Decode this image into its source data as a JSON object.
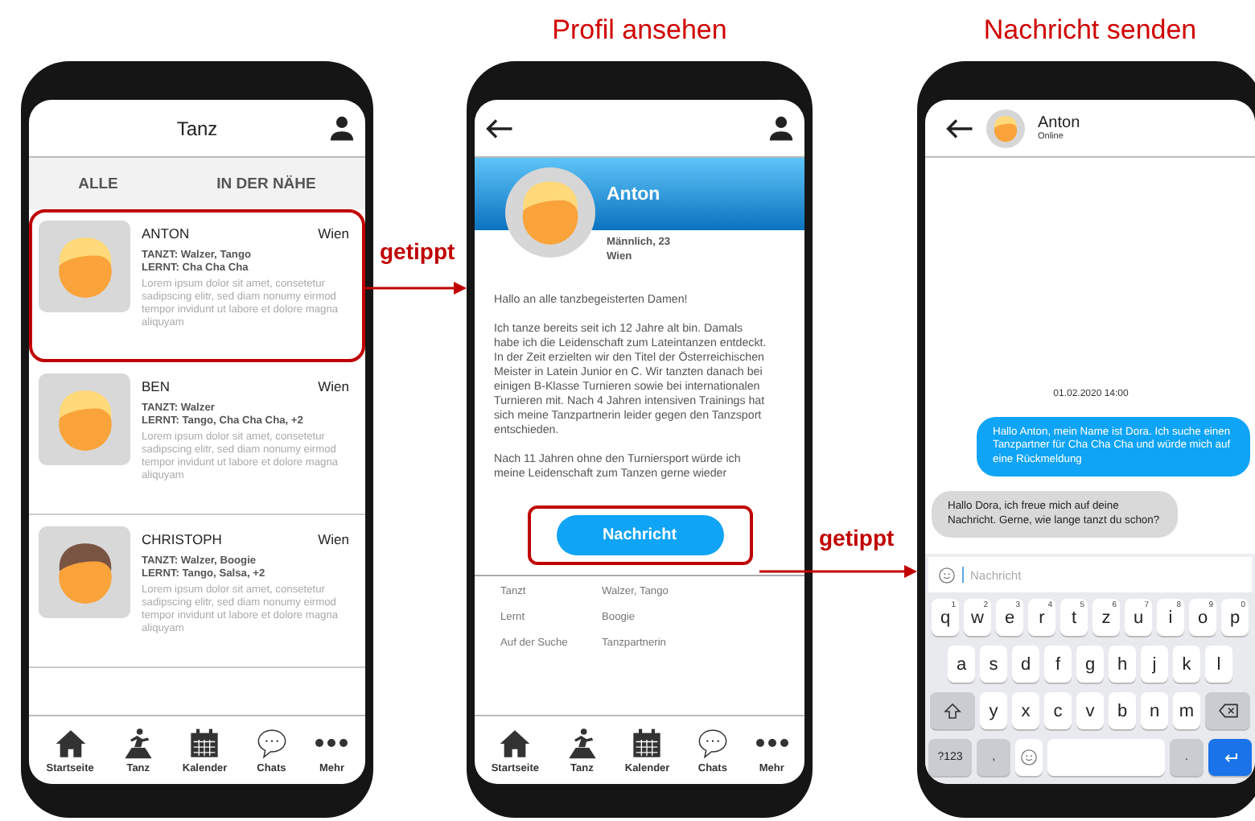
{
  "screens": [
    {
      "kind": "list",
      "header": {
        "title": "Tanz"
      },
      "tabs": [
        {
          "label": "ALLE"
        },
        {
          "label": "IN DER NÄHE"
        }
      ],
      "cards": [
        {
          "name": "ANTON",
          "city": "Wien",
          "dances": "TANZT: Walzer, Tango",
          "learns": "LERNT: Cha Cha Cha",
          "text": "Lorem ipsum dolor sit amet, consetetur sadipscing elitr, sed diam nonumy eirmod tempor invidunt ut labore et dolore magna aliquyam",
          "color": "#ffd97a",
          "highlighted": true
        },
        {
          "name": "BEN",
          "city": "Wien",
          "dances": "TANZT: Walzer",
          "learns": "LERNT: Tango, Cha Cha Cha, +2",
          "text": "Lorem ipsum dolor sit amet, consetetur sadipscing elitr, sed diam nonumy eirmod tempor invidunt ut labore et dolore magna aliquyam",
          "color": "#ffd97a",
          "highlighted": false
        },
        {
          "name": "CHRISTOPH",
          "city": "Wien",
          "dances": "TANZT: Walzer, Boogie",
          "learns": "LERNT: Tango, Salsa, +2",
          "text": "Lorem ipsum dolor sit amet, consetetur sadipscing elitr, sed diam nonumy eirmod tempor invidunt ut labore et dolore magna aliquyam",
          "color": "#7a5443",
          "highlighted": false
        }
      ],
      "nav": [
        {
          "kind": "home",
          "label": "Startseite"
        },
        {
          "kind": "dance",
          "label": "Tanz"
        },
        {
          "kind": "calendar",
          "label": "Kalender"
        },
        {
          "kind": "chats",
          "label": "Chats"
        },
        {
          "kind": "more",
          "label": "Mehr"
        }
      ],
      "transition": {
        "label": "getippt"
      }
    },
    {
      "kind": "profile",
      "title": "Profil ansehen",
      "name": "Anton",
      "details": [
        "Männlich, 23",
        "Wien"
      ],
      "bio": [
        "Hallo an alle tanzbegeisterten Damen!",
        "Ich tanze bereits seit ich 12 Jahre alt bin. Damals habe ich die Leidenschaft zum Lateintanzen entdeckt.\nIn der Zeit erzielten wir den Titel der Österreichischen Meister in Latein Junior en C. Wir tanzten danach bei einigen B-Klasse Turnieren sowie bei internationalen Turnieren mit. Nach 4 Jahren intensiven Trainings hat sich meine Tanzpartnerin leider gegen den Tanzsport entschieden.",
        "Nach 11 Jahren ohne den Turniersport würde ich meine Leidenschaft zum Tanzen gerne wieder"
      ],
      "action": {
        "label": "Nachricht",
        "highlighted": true
      },
      "facts": [
        {
          "label": "Tanzt",
          "value": "Walzer, Tango"
        },
        {
          "label": "Lernt",
          "value": "Boogie"
        },
        {
          "label": "Auf der Suche",
          "value": "Tanzpartnerin"
        }
      ],
      "nav": [
        {
          "kind": "home",
          "label": "Startseite"
        },
        {
          "kind": "dance",
          "label": "Tanz"
        },
        {
          "kind": "calendar",
          "label": "Kalender"
        },
        {
          "kind": "chats",
          "label": "Chats"
        },
        {
          "kind": "more",
          "label": "Mehr"
        }
      ],
      "transition": {
        "label": "getippt"
      }
    },
    {
      "kind": "chat",
      "title": "Nachricht senden",
      "contact": {
        "name": "Anton",
        "status": "Online"
      },
      "date": "01.02.2020 14:00",
      "messages": [
        {
          "kind": "sent",
          "text": "Hallo Anton, mein Name ist Dora. Ich suche einen Tanzpartner für Cha Cha Cha und würde mich auf eine Rückmeldung"
        },
        {
          "kind": "received",
          "text": "Hallo Dora, ich freue mich auf deine Nachricht. Gerne, wie lange tanzt du schon?"
        }
      ],
      "composer": {
        "placeholder": "Nachricht"
      },
      "keyboard": [
        [
          {
            "kind": "letter",
            "label": "q",
            "hint": "1"
          },
          {
            "kind": "letter",
            "label": "w",
            "hint": "2"
          },
          {
            "kind": "letter",
            "label": "e",
            "hint": "3"
          },
          {
            "kind": "letter",
            "label": "r",
            "hint": "4"
          },
          {
            "kind": "letter",
            "label": "t",
            "hint": "5"
          },
          {
            "kind": "letter",
            "label": "z",
            "hint": "6"
          },
          {
            "kind": "letter",
            "label": "u",
            "hint": "7"
          },
          {
            "kind": "letter",
            "label": "i",
            "hint": "8"
          },
          {
            "kind": "letter",
            "label": "o",
            "hint": "9"
          },
          {
            "kind": "letter",
            "label": "p",
            "hint": "0"
          }
        ],
        [
          {
            "kind": "letter",
            "label": "a"
          },
          {
            "kind": "letter",
            "label": "s"
          },
          {
            "kind": "letter",
            "label": "d"
          },
          {
            "kind": "letter",
            "label": "f"
          },
          {
            "kind": "letter",
            "label": "g"
          },
          {
            "kind": "letter",
            "label": "h"
          },
          {
            "kind": "letter",
            "label": "j"
          },
          {
            "kind": "letter",
            "label": "k"
          },
          {
            "kind": "letter",
            "label": "l"
          }
        ],
        [
          {
            "kind": "shift"
          },
          {
            "kind": "letter",
            "label": "y"
          },
          {
            "kind": "letter",
            "label": "x"
          },
          {
            "kind": "letter",
            "label": "c"
          },
          {
            "kind": "letter",
            "label": "v"
          },
          {
            "kind": "letter",
            "label": "b"
          },
          {
            "kind": "letter",
            "label": "n"
          },
          {
            "kind": "letter",
            "label": "m"
          },
          {
            "kind": "backspace"
          }
        ],
        [
          {
            "kind": "function",
            "label": "?123"
          },
          {
            "kind": "function",
            "label": ","
          },
          {
            "kind": "emoji"
          },
          {
            "kind": "space"
          },
          {
            "kind": "function",
            "label": "."
          },
          {
            "kind": "enter"
          }
        ]
      ]
    }
  ]
}
